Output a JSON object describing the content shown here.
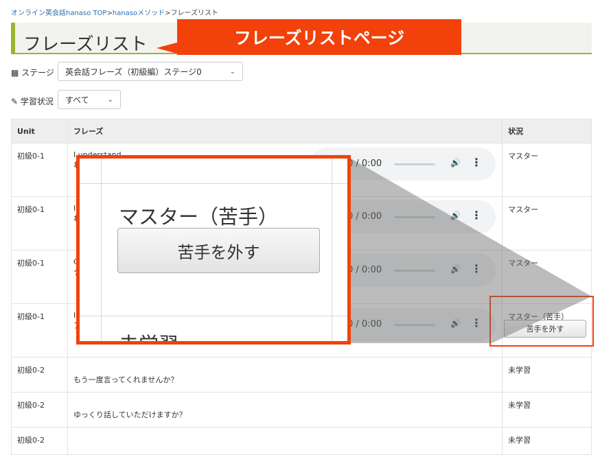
{
  "breadcrumb": {
    "site": "オンライン英会話hanaso",
    "sep": " ",
    "top": "TOP",
    "arrow1": ">",
    "method": "hanasoメソッド",
    "arrow2": ">",
    "current": "フレーズリスト"
  },
  "page": {
    "title": "フレーズリスト",
    "callout": "フレーズリストページ"
  },
  "filters": {
    "stage_label": "ステージ",
    "stage_value": "英会話フレーズ（初級編）ステージ0",
    "status_label": "学習状況",
    "status_value": "すべて"
  },
  "table": {
    "headers": [
      "Unit",
      "フレーズ",
      "状況"
    ],
    "rows": [
      {
        "unit": "初級0-1",
        "phrase": "I understand.",
        "phrase2": "わ",
        "status": "マスター",
        "button": ""
      },
      {
        "unit": "初級0-1",
        "phrase": "I",
        "phrase2": "わ",
        "status": "マスター",
        "button": ""
      },
      {
        "unit": "初級0-1",
        "phrase": "C",
        "phrase2": "ク",
        "status": "マスター",
        "button": ""
      },
      {
        "unit": "初級0-1",
        "phrase": "I",
        "phrase2": "ア",
        "status": "マスター（苦手）",
        "button": "苦手を外す"
      },
      {
        "unit": "初級0-2",
        "phrase": "",
        "phrase2": "もう一度言ってくれませんか？",
        "status": "未学習",
        "button": ""
      },
      {
        "unit": "初級0-2",
        "phrase": "",
        "phrase2": "ゆっくり話していただけますか？",
        "status": "未学習",
        "button": ""
      },
      {
        "unit": "初級0-2",
        "phrase": "",
        "phrase2": "",
        "status": "未学習",
        "button": ""
      }
    ]
  },
  "audio": {
    "time": "0 / 0:00"
  },
  "zoom": {
    "status": "マスター（苦手）",
    "button": "苦手を外す",
    "next_status": "未学習"
  },
  "colors": {
    "accent": "#f2410b",
    "title_bar": "#9ab531"
  },
  "icons": {
    "stage": "book-icon",
    "status": "pencil-icon",
    "volume": "volume-icon",
    "menu": "more-vert-icon"
  }
}
